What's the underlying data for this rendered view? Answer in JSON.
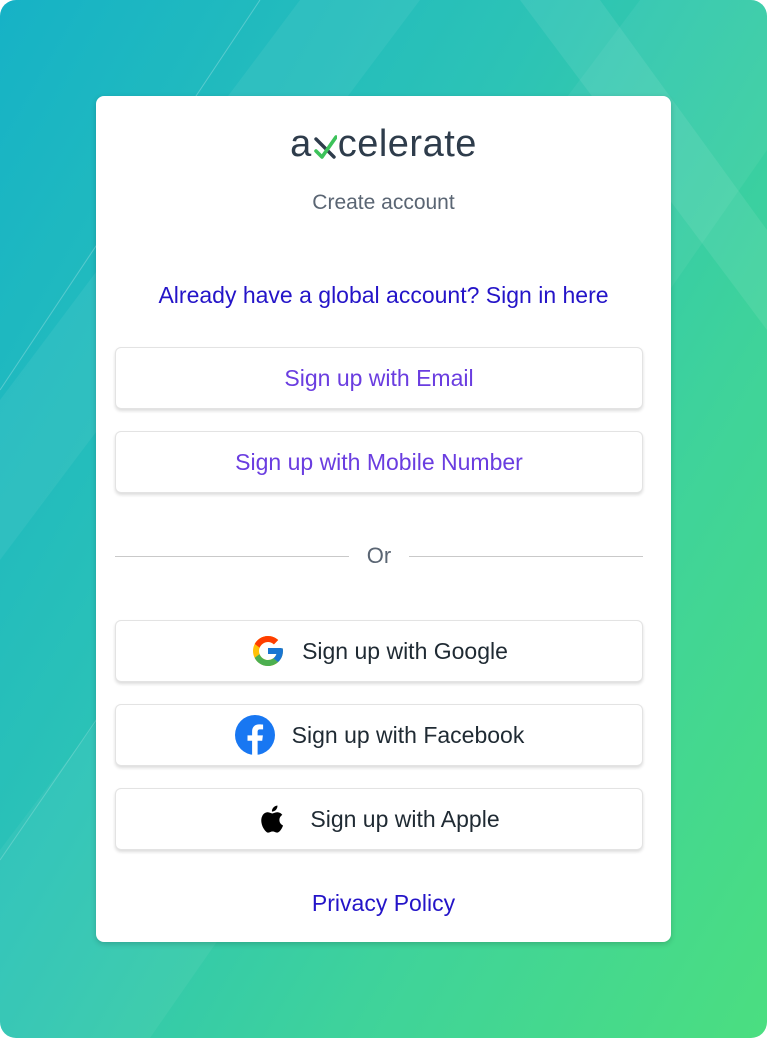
{
  "brand": {
    "logo_prefix": "a",
    "logo_suffix": "celerate",
    "logo_mark_icon": "x-check-mark-icon",
    "logo_mark_color": "#3cc25a",
    "logo_text_color": "#2e3c4b"
  },
  "page": {
    "subtitle": "Create account",
    "signin_link": "Already have a global account? Sign in here",
    "divider_label": "Or",
    "privacy_link": "Privacy Policy"
  },
  "buttons": {
    "email": "Sign up with Email",
    "mobile": "Sign up with Mobile Number",
    "google": "Sign up with Google",
    "facebook": "Sign up with Facebook",
    "apple": "Sign up with Apple"
  },
  "colors": {
    "primary_button_text": "#6a3de0",
    "link": "#2414c8",
    "background_start": "#16b2c6",
    "background_end": "#4bde80"
  }
}
